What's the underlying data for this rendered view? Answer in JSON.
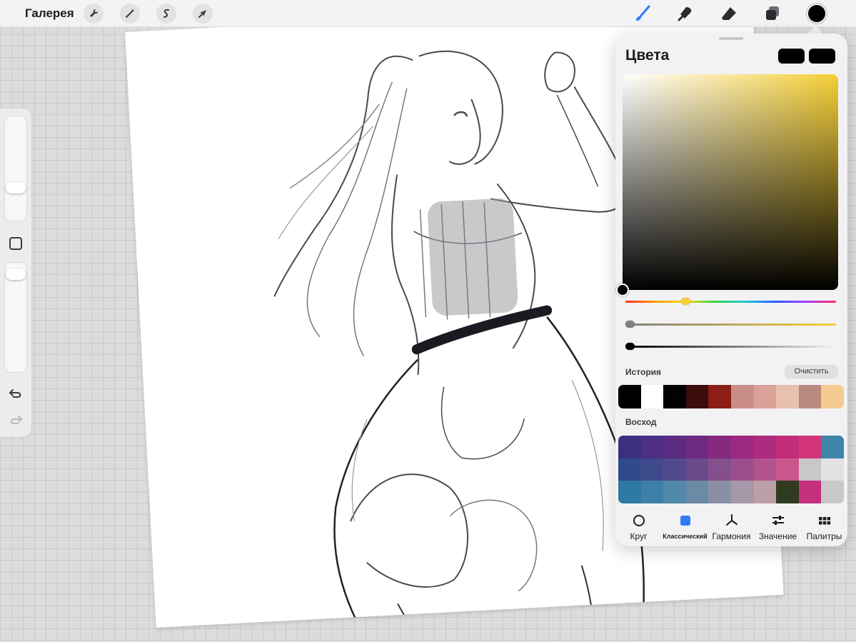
{
  "toolbar": {
    "gallery_label": "Галерея",
    "left_tools": [
      "wrench-icon",
      "magic-wand-icon",
      "selection-s-icon",
      "move-arrow-icon"
    ],
    "right_tools": [
      "brush-icon",
      "smudge-icon",
      "eraser-icon",
      "layers-icon"
    ],
    "current_color": "#000000"
  },
  "colors_panel": {
    "title": "Цвета",
    "primary_swatch": "#000000",
    "secondary_swatch": "#000000",
    "hue_color": "#f5cf37",
    "history_label": "История",
    "clear_label": "Очистить",
    "history_colors": [
      "#000000",
      "#ffffff",
      "#020202",
      "#3a0d0a",
      "#8b1e16",
      "#c98e88",
      "#d8a19a",
      "#e8c0ad",
      "#b88a80",
      "#f5cb90"
    ],
    "palette_label": "Восход",
    "palette_colors": [
      "#3b2f7f",
      "#4c2f84",
      "#5a2c82",
      "#6e2a80",
      "#862a80",
      "#9c297f",
      "#ad2a7e",
      "#c42d7b",
      "#d23579",
      "#3e84a8",
      "#2f4b89",
      "#3f4a8d",
      "#514b8d",
      "#694b8a",
      "#854e8c",
      "#9b4e8e",
      "#b1538c",
      "#c9598d",
      "#c8c8ca",
      "#e2e2e4",
      "#2f7aa2",
      "#3e80a6",
      "#5089a9",
      "#6a8aa6",
      "#8a8fa3",
      "#a698a8",
      "#bda0a6",
      "#303a1e",
      "#c4307b",
      "#c8c8ca"
    ],
    "tabs": [
      {
        "label": "Круг",
        "icon": "circle-icon"
      },
      {
        "label": "Классический",
        "icon": "square-icon"
      },
      {
        "label": "Гармония",
        "icon": "harmony-icon"
      },
      {
        "label": "Значение",
        "icon": "sliders-icon"
      },
      {
        "label": "Палитры",
        "icon": "grid-icon"
      }
    ],
    "active_tab": "Классический"
  },
  "sidebar": {
    "controls": [
      "brush-size-slider",
      "modify-button",
      "opacity-slider",
      "undo-icon",
      "redo-icon"
    ]
  }
}
